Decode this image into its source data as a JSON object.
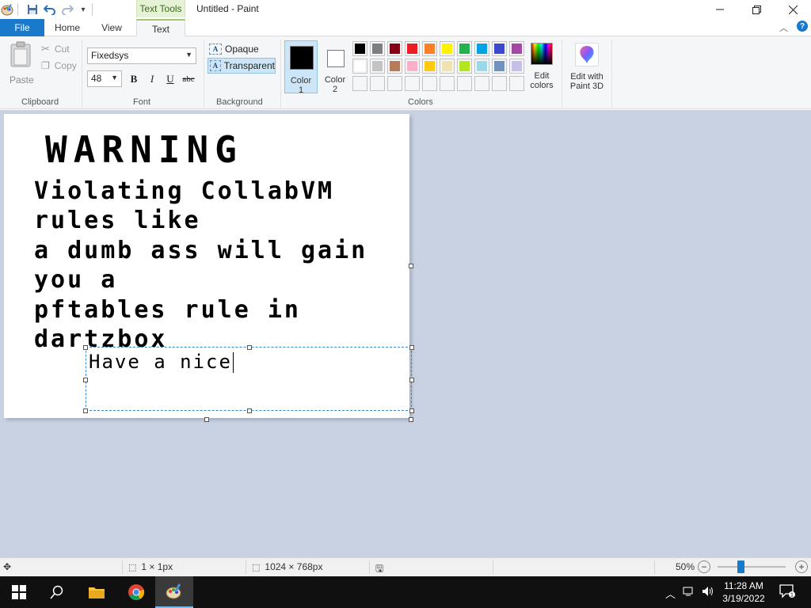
{
  "window": {
    "title": "Untitled - Paint",
    "contextual_tab": "Text Tools"
  },
  "tabs": {
    "file": "File",
    "home": "Home",
    "view": "View",
    "text": "Text"
  },
  "ribbon": {
    "clipboard": {
      "label": "Clipboard",
      "paste": "Paste",
      "cut": "Cut",
      "copy": "Copy"
    },
    "font": {
      "label": "Font",
      "family": "Fixedsys",
      "size": "48",
      "bold": "B",
      "italic": "I",
      "underline": "U",
      "strikethrough": "abc"
    },
    "background": {
      "label": "Background",
      "opaque": "Opaque",
      "transparent": "Transparent",
      "selected": "Transparent"
    },
    "colors": {
      "label": "Colors",
      "color1_label": "Color\n1",
      "color1_value": "#000000",
      "color2_label": "Color\n2",
      "color2_value": "#ffffff",
      "edit_colors": "Edit\ncolors",
      "palette_row1": [
        "#000000",
        "#7f7f7f",
        "#880015",
        "#ed1c24",
        "#ff7f27",
        "#fff200",
        "#22b14c",
        "#00a2e8",
        "#3f48cc",
        "#a349a4"
      ],
      "palette_row2": [
        "#ffffff",
        "#c3c3c3",
        "#b97a57",
        "#ffaec9",
        "#ffc90e",
        "#efe4b0",
        "#b5e61d",
        "#99d9ea",
        "#7092be",
        "#c8bfe7"
      ],
      "palette_row3_count": 10
    },
    "paint3d": "Edit with\nPaint 3D"
  },
  "canvas": {
    "heading": "WARNING",
    "lines": [
      "Violating CollabVM",
      "rules like",
      "a dumb ass will gain",
      "you a",
      "pftables rule in",
      "dartzbox"
    ],
    "textbox_text": "Have a nice"
  },
  "status": {
    "selection_size": "1 × 1px",
    "image_size": "1024 × 768px",
    "zoom": "50%",
    "zoom_fraction": 0.5
  },
  "taskbar": {
    "time": "11:28 AM",
    "date": "3/19/2022"
  }
}
